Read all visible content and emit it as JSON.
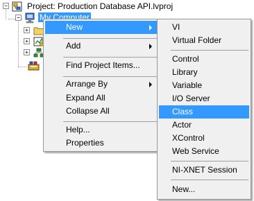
{
  "tree": {
    "project_label": "Project: Production Database API.lvproj",
    "computer_label": "My Computer"
  },
  "context_menu": {
    "items": [
      {
        "label": "New",
        "highlighted": true,
        "has_submenu": true
      },
      {
        "label": "Add",
        "has_submenu": true
      },
      {
        "label": "Find Project Items..."
      },
      {
        "label": "Arrange By",
        "has_submenu": true
      },
      {
        "label": "Expand All"
      },
      {
        "label": "Collapse All"
      },
      {
        "label": "Help..."
      },
      {
        "label": "Properties"
      }
    ]
  },
  "submenu_new": {
    "items": [
      {
        "label": "VI"
      },
      {
        "label": "Virtual Folder"
      },
      {
        "label": "Control"
      },
      {
        "label": "Library"
      },
      {
        "label": "Variable"
      },
      {
        "label": "I/O Server"
      },
      {
        "label": "Class",
        "highlighted": true
      },
      {
        "label": "Actor"
      },
      {
        "label": "XControl"
      },
      {
        "label": "Web Service"
      },
      {
        "label": "NI-XNET Session"
      },
      {
        "label": "New..."
      }
    ]
  },
  "colors": {
    "highlight": "#3399ff",
    "menu_background": "#f0f0f0",
    "menu_border": "#979797"
  },
  "icons": [
    "expand-collapse-icon",
    "project-icon",
    "computer-icon",
    "folder-icon",
    "vi-icon",
    "network-icon",
    "dependencies-icon",
    "submenu-arrow-icon"
  ]
}
